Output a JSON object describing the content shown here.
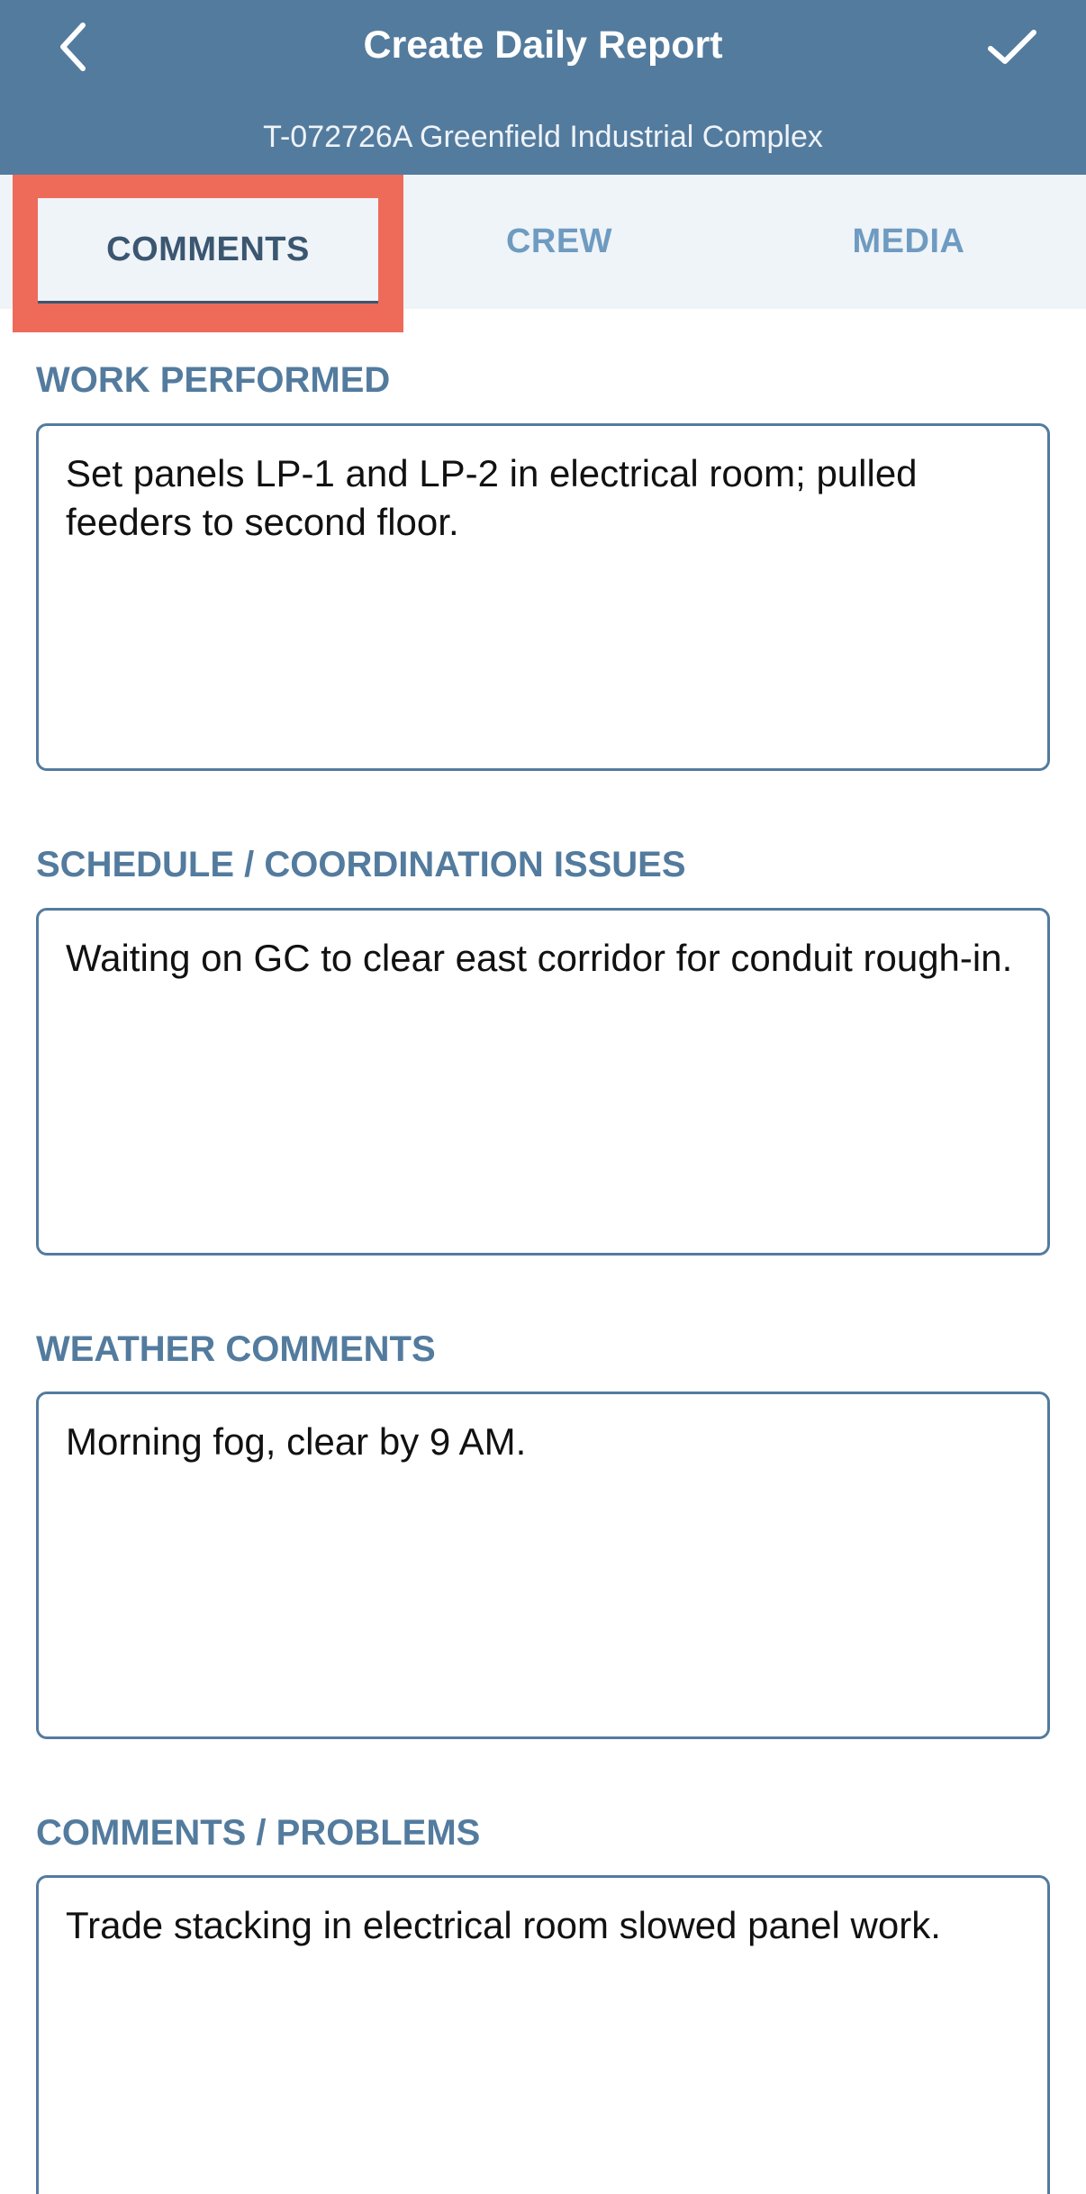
{
  "header": {
    "title": "Create Daily Report",
    "subtitle": "T-072726A Greenfield Industrial Complex",
    "back_icon": "chevron-left-icon",
    "save_icon": "checkmark-icon",
    "color": "#537b9e"
  },
  "tabs": [
    {
      "label": "COMMENTS",
      "selected": true
    },
    {
      "label": "CREW",
      "selected": false
    },
    {
      "label": "MEDIA",
      "selected": false
    }
  ],
  "highlight_color": "#ee6b5a",
  "sections": {
    "work_performed": {
      "label": "WORK PERFORMED",
      "value": "Set panels LP-1 and LP-2 in electrical room; pulled feeders to second floor."
    },
    "schedule": {
      "label": "SCHEDULE / COORDINATION ISSUES",
      "value": "Waiting on GC to clear east corridor for conduit rough-in."
    },
    "weather": {
      "label": "WEATHER COMMENTS",
      "value": "Morning fog, clear by 9 AM."
    },
    "comments_problems": {
      "label": "COMMENTS / PROBLEMS",
      "value": "Trade stacking in electrical room slowed panel work."
    }
  }
}
